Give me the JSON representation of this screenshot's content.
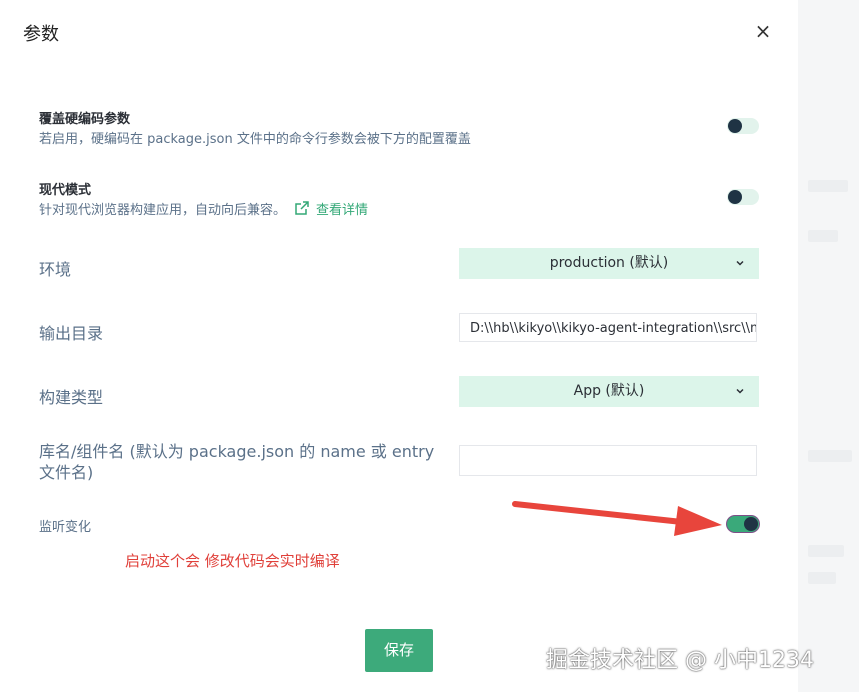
{
  "dialog": {
    "title": "参数",
    "close_glyph": "×"
  },
  "override": {
    "title": "覆盖硬编码参数",
    "desc": "若启用，硬编码在 package.json 文件中的命令行参数会被下方的配置覆盖",
    "enabled": false
  },
  "modern": {
    "title": "现代模式",
    "desc": "针对现代浏览器构建应用，自动向后兼容。",
    "link_text": "查看详情",
    "link_icon": "external-link-icon",
    "enabled": false
  },
  "env": {
    "label": "环境",
    "value": "production (默认)"
  },
  "output": {
    "label": "输出目录",
    "value": "D:\\\\hb\\\\kikyo\\\\kikyo-agent-integration\\\\src\\\\mo"
  },
  "build_type": {
    "label": "构建类型",
    "value": "App (默认)"
  },
  "lib_name": {
    "label": "库名/组件名 (默认为 package.json 的 name 或 entry 文件名)",
    "value": ""
  },
  "watch": {
    "label": "监听变化",
    "enabled": true
  },
  "annotation": {
    "note": "启动这个会 修改代码会实时编译",
    "color": "#e0403a"
  },
  "footer": {
    "save_label": "保存"
  },
  "watermark": "掘金技术社区 @ 小中1234",
  "colors": {
    "accent": "#3daa7b",
    "select_bg": "#dcf5ea",
    "toggle_off_bg": "#e2f3ec",
    "knob": "#1f3344"
  }
}
